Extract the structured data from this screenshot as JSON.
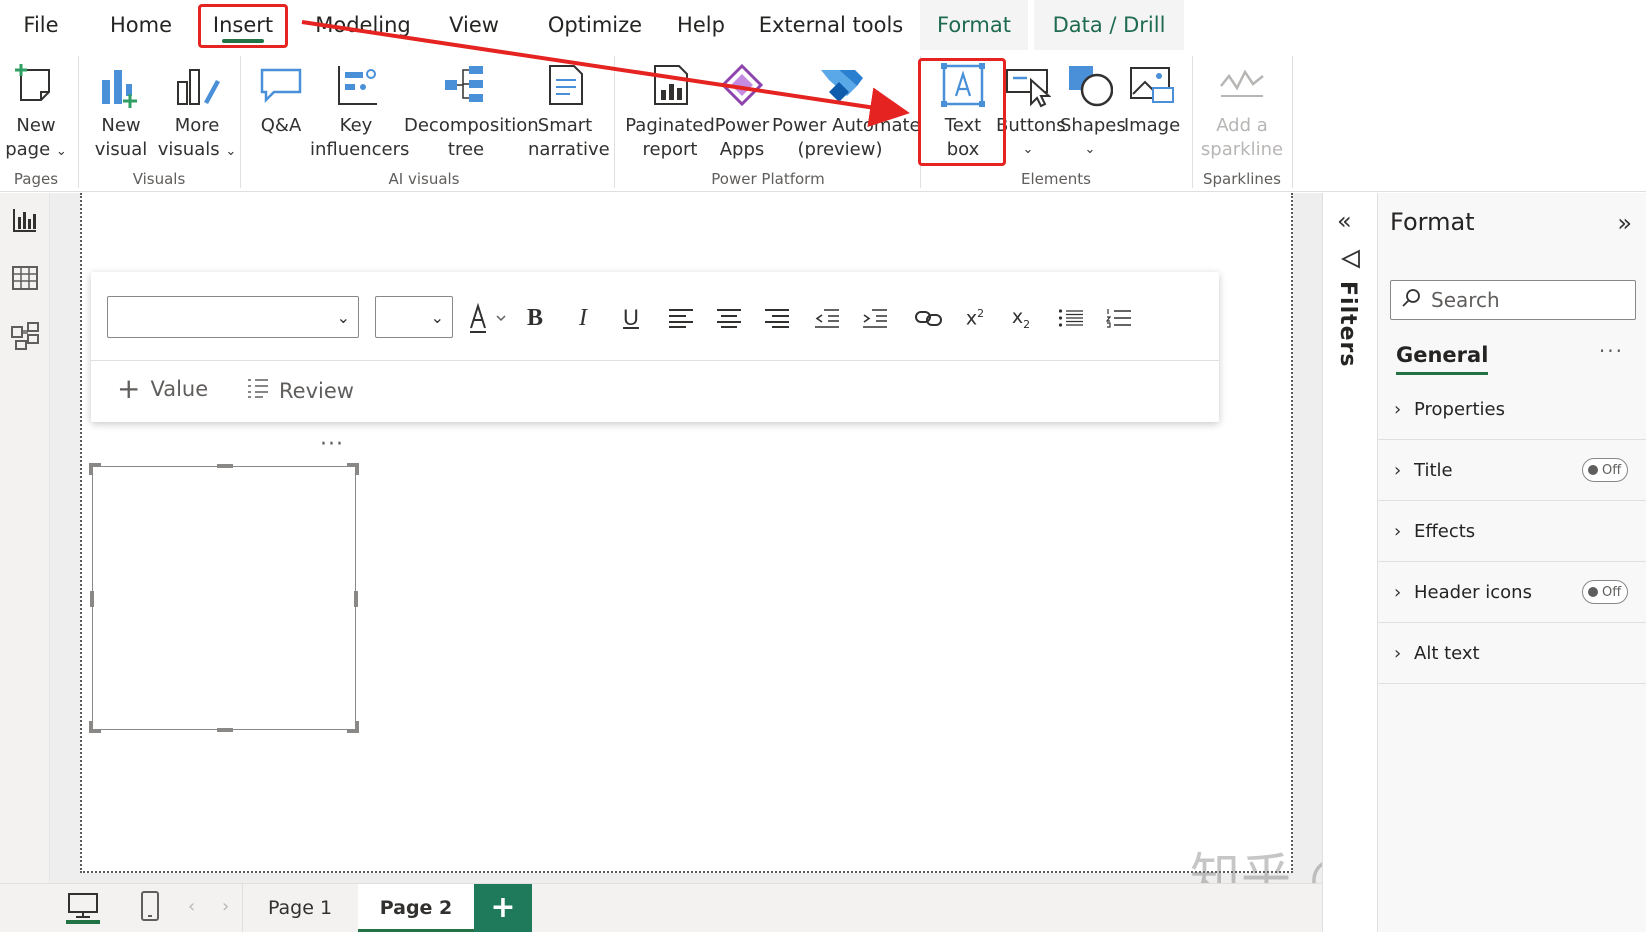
{
  "menu": {
    "tabs": [
      "File",
      "Home",
      "Insert",
      "Modeling",
      "View",
      "Optimize",
      "Help",
      "External tools",
      "Format",
      "Data / Drill"
    ],
    "active": "Insert"
  },
  "ribbon": {
    "groups": {
      "pages": "Pages",
      "visuals": "Visuals",
      "ai_visuals": "AI visuals",
      "power_platform": "Power Platform",
      "elements": "Elements",
      "sparklines": "Sparklines"
    },
    "buttons": {
      "new_page": [
        "New",
        "page"
      ],
      "new_visual": [
        "New",
        "visual"
      ],
      "more_visuals": [
        "More",
        "visuals"
      ],
      "qa": "Q&A",
      "key_influencers": [
        "Key",
        "influencers"
      ],
      "decomposition_tree": [
        "Decomposition",
        "tree"
      ],
      "smart_narrative": [
        "Smart",
        "narrative"
      ],
      "paginated_report": [
        "Paginated",
        "report"
      ],
      "power_apps": [
        "Power",
        "Apps"
      ],
      "power_automate": [
        "Power Automate",
        "(preview)"
      ],
      "text_box": [
        "Text",
        "box"
      ],
      "buttons": "Buttons",
      "shapes": "Shapes",
      "image": "Image",
      "add_sparkline": [
        "Add a",
        "sparkline"
      ]
    }
  },
  "textbox_toolbar": {
    "add_value": "Value",
    "review": "Review"
  },
  "filters": {
    "label": "Filters"
  },
  "format_pane": {
    "title": "Format",
    "search_placeholder": "Search",
    "tab": "General",
    "sections": [
      {
        "label": "Properties",
        "toggle": null
      },
      {
        "label": "Title",
        "toggle": "Off"
      },
      {
        "label": "Effects",
        "toggle": null
      },
      {
        "label": "Header icons",
        "toggle": "Off"
      },
      {
        "label": "Alt text",
        "toggle": null
      }
    ]
  },
  "pages": {
    "tabs": [
      "Page 1",
      "Page 2"
    ],
    "active": "Page 2"
  },
  "watermark": "知乎 @CubeDance",
  "colors": {
    "accent": "#217346",
    "highlight": "#e52421",
    "add_page": "#1e7a5a"
  }
}
